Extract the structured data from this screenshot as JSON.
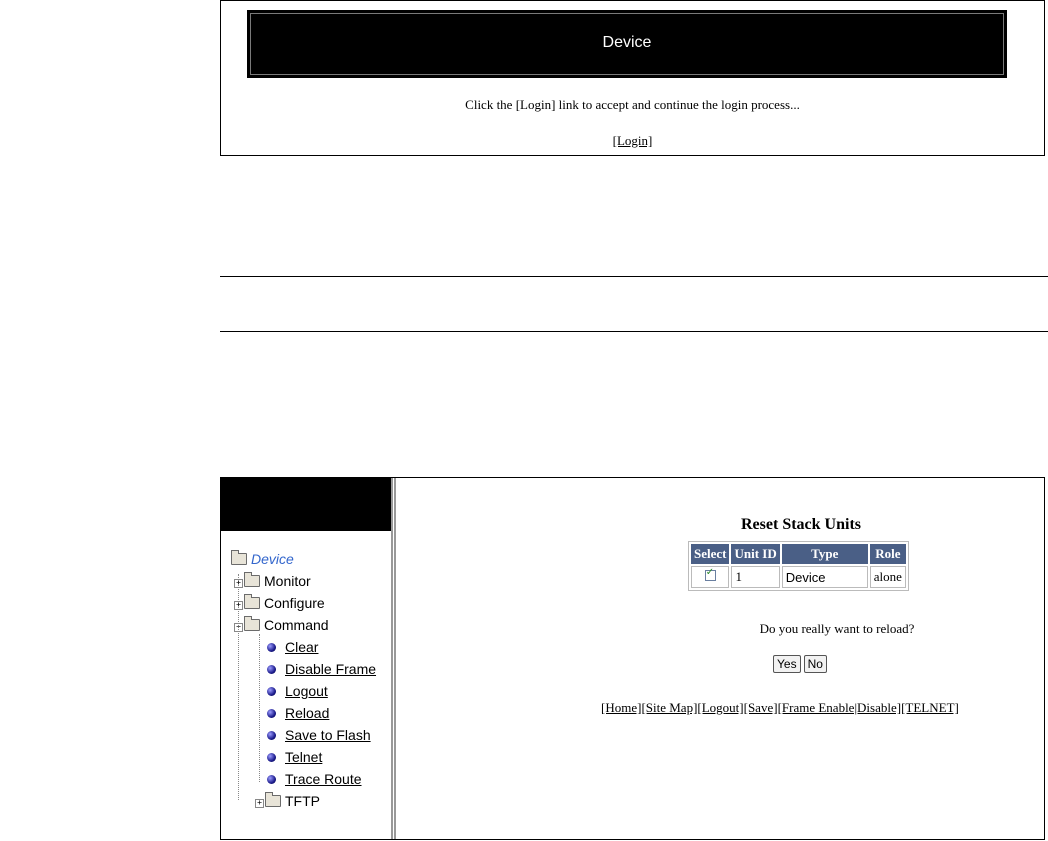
{
  "login_screen": {
    "banner_title": "Device",
    "message": "Click the [Login] link to accept and continue the login process...",
    "login_link": "[Login]"
  },
  "reload_screen": {
    "tree": {
      "root": "Device",
      "items": [
        {
          "label": "Monitor",
          "kind": "folder"
        },
        {
          "label": "Configure",
          "kind": "folder"
        },
        {
          "label": "Command",
          "kind": "folder-open"
        },
        {
          "label": "Clear",
          "kind": "link"
        },
        {
          "label": "Disable Frame",
          "kind": "link"
        },
        {
          "label": "Logout",
          "kind": "link"
        },
        {
          "label": "Reload",
          "kind": "link"
        },
        {
          "label": "Save to Flash",
          "kind": "link"
        },
        {
          "label": "Telnet",
          "kind": "link"
        },
        {
          "label": "Trace Route",
          "kind": "link"
        },
        {
          "label": "TFTP",
          "kind": "folder"
        }
      ]
    },
    "panel_title": "Reset Stack Units",
    "table": {
      "headers": [
        "Select",
        "Unit ID",
        "Type",
        "Role"
      ],
      "rows": [
        {
          "selected": true,
          "unit_id": "1",
          "type": "Device",
          "role": "alone"
        }
      ]
    },
    "question": "Do you really want to reload?",
    "yes_label": "Yes",
    "no_label": "No",
    "nav_links": [
      "[Home]",
      "[Site Map]",
      "[Logout]",
      "[Save]",
      "[Frame Enable|Disable]",
      "[TELNET]"
    ]
  }
}
